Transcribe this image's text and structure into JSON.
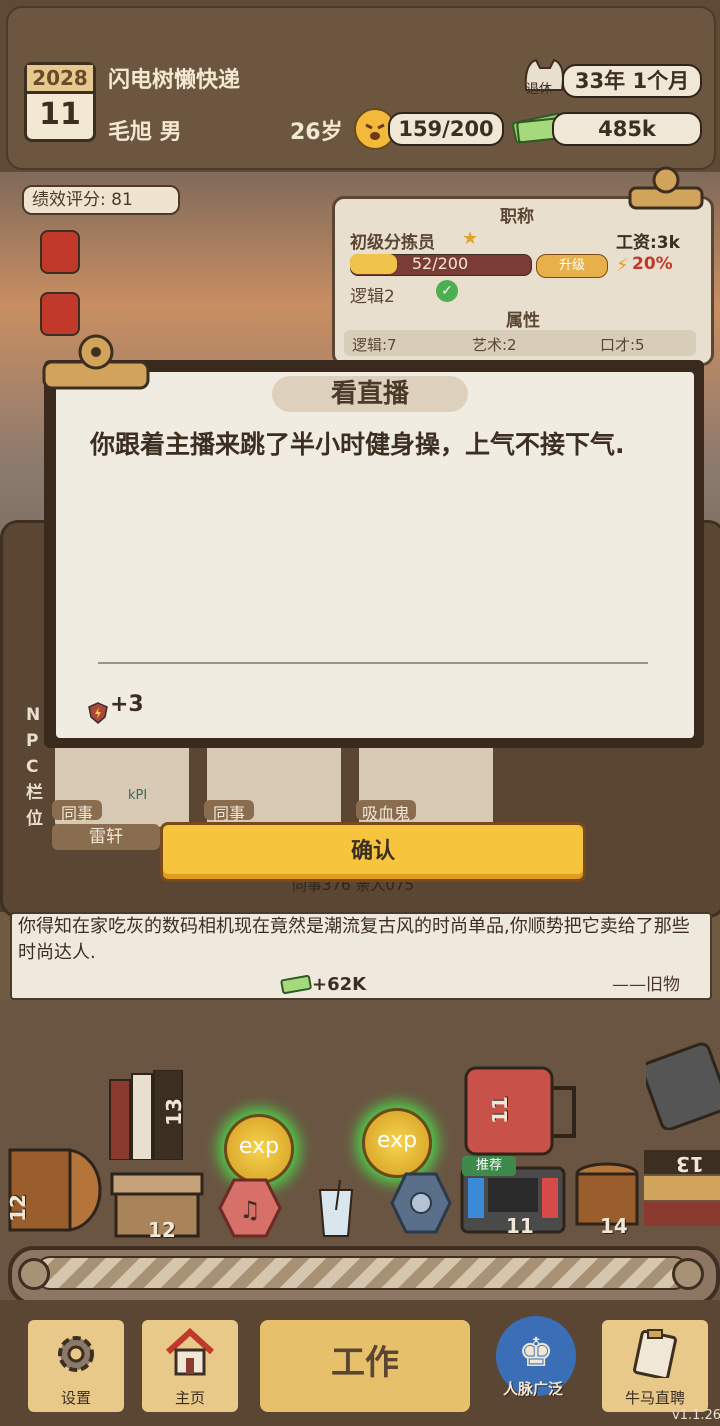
{
  "header": {
    "calendar_year": "2028",
    "calendar_day": "11",
    "company": "闪电树懒快递",
    "player": "毛旭 男",
    "age": "26岁",
    "mood": "159/200",
    "retire_badge": "退休",
    "retire_time": "33年 1个月",
    "money": "485k"
  },
  "performance": "绩效评分: 81",
  "job_panel": {
    "title": "职称",
    "position": "初级分拣员",
    "salary": "工资:3k",
    "progress_text": "52/200",
    "progress_fraction": 0.26,
    "promote_label": "升级",
    "bonus": "20%",
    "skill_req": "逻辑2",
    "attr_title": "属性",
    "attrs": [
      "逻辑:7",
      "艺术:2",
      "口才:5"
    ]
  },
  "modal": {
    "title": "看直播",
    "body": "你跟着主播来跳了半小时健身操，上气不接下气.",
    "reward": "+3"
  },
  "confirm_label": "确认",
  "npc": {
    "column_label": [
      "N",
      "P",
      "C",
      "栏",
      "位"
    ],
    "cards": [
      {
        "tag": "同事",
        "name": "雷轩",
        "badge": "kPI"
      },
      {
        "tag": "同事",
        "name": ""
      },
      {
        "tag": "吸血鬼",
        "name": ""
      }
    ],
    "partial_label": "同事376 亲人075"
  },
  "event_log": {
    "text": "你得知在家吃灰的数码相机现在竟然是潮流复古风的时尚单品,你顺势把它卖给了那些时尚达人.",
    "money": "+62K",
    "source": "——旧物"
  },
  "shelf_items": [
    {
      "name": "books",
      "count": "13"
    },
    {
      "name": "barrel-left",
      "count": "12"
    },
    {
      "name": "box",
      "count": "12"
    },
    {
      "name": "exp-orb-1",
      "label": "exp"
    },
    {
      "name": "exp-orb-2",
      "label": "exp"
    },
    {
      "name": "suitcase",
      "count": "11"
    },
    {
      "name": "game-console",
      "count": "11",
      "tag": "推荐"
    },
    {
      "name": "barrel-right",
      "count": "14"
    },
    {
      "name": "stack-right",
      "count": "13"
    }
  ],
  "nav": {
    "settings": "设置",
    "home": "主页",
    "work": "工作",
    "network": "人脉广泛",
    "live": "牛马直聘"
  },
  "version": "v1.1.26",
  "colors": {
    "accent_yellow": "#f6c43d",
    "panel_brown": "#5b4634",
    "card_bg": "#f0ece2",
    "exp_glow": "#4fd04a"
  }
}
